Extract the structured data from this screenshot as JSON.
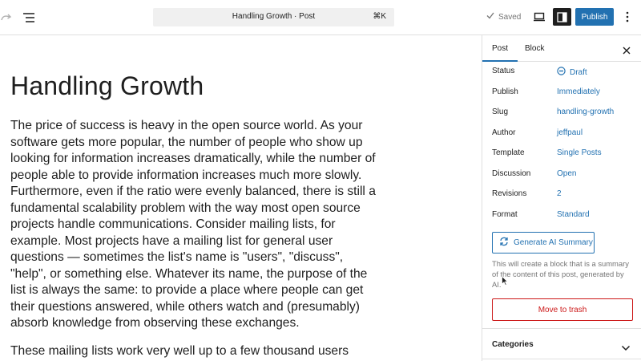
{
  "toolbar": {
    "document_title": "Handling Growth · Post",
    "shortcut": "⌘K",
    "saved_label": "Saved",
    "publish_label": "Publish"
  },
  "post": {
    "title": "Handling Growth",
    "paragraph1": "The price of success is heavy in the open source world. As your software gets more popular, the number of people who show up looking for information increases dramatically, while the number of people able to provide information increases much more slowly. Furthermore, even if the ratio were evenly balanced, there is still a fundamental scalability problem with the way most open source projects handle communications. Consider mailing lists, for example. Most projects have a mailing list for general user questions — sometimes the list's name is \"users\", \"discuss\", \"help\", or something else. Whatever its name, the purpose of the list is always the same: to provide a place where people can get their questions answered, while others watch and (presumably) absorb knowledge from observing these exchanges.",
    "paragraph2": "These mailing lists work very well up to a few thousand users and/or a"
  },
  "sidebar": {
    "tabs": [
      "Post",
      "Block"
    ],
    "active_tab": "Post",
    "rows": [
      {
        "label": "Status",
        "value": "Draft"
      },
      {
        "label": "Publish",
        "value": "Immediately"
      },
      {
        "label": "Slug",
        "value": "handling-growth"
      },
      {
        "label": "Author",
        "value": "jeffpaul"
      },
      {
        "label": "Template",
        "value": "Single Posts"
      },
      {
        "label": "Discussion",
        "value": "Open"
      },
      {
        "label": "Revisions",
        "value": "2"
      },
      {
        "label": "Format",
        "value": "Standard"
      }
    ],
    "generate_button": "Generate AI Summary",
    "generate_help": "This will create a block that is a summary of the content of this post, generated by AI.",
    "trash_button": "Move to trash",
    "categories_label": "Categories"
  },
  "colors": {
    "accent": "#2271b1",
    "danger": "#cc1818",
    "muted": "#757575"
  }
}
